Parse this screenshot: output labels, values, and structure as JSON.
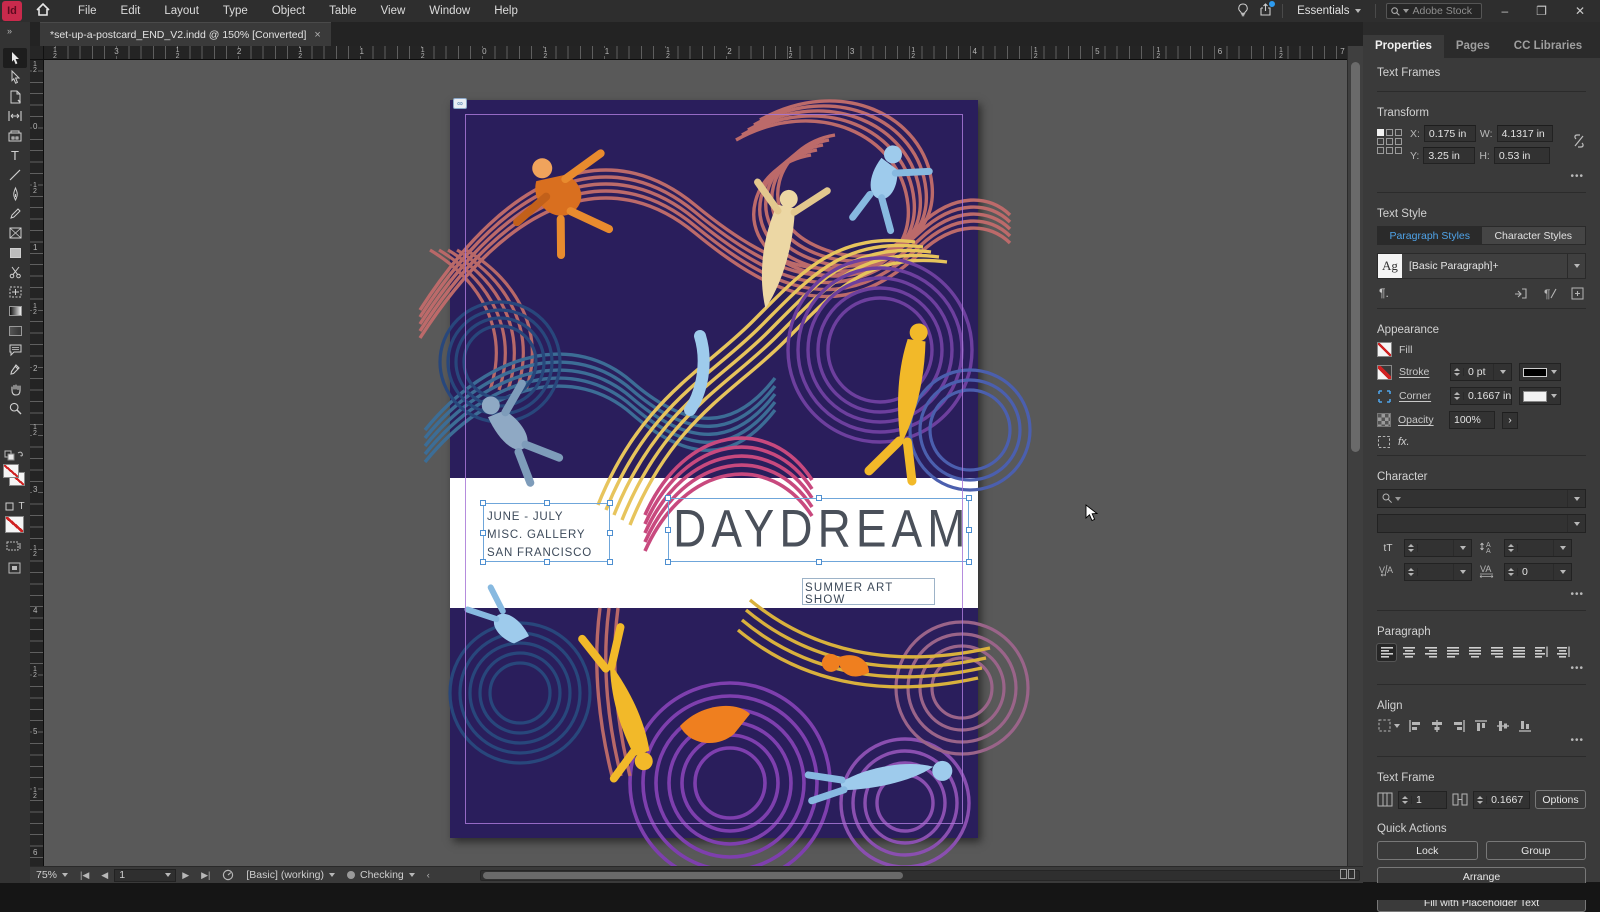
{
  "app": {
    "logo": "Id",
    "menu": [
      "File",
      "Edit",
      "Layout",
      "Type",
      "Object",
      "Table",
      "View",
      "Window",
      "Help"
    ],
    "workspace": "Essentials",
    "search_placeholder": "Adobe Stock",
    "window_buttons": {
      "minimize": "–",
      "restore": "❐",
      "close": "✕"
    }
  },
  "document_tab": {
    "title": "*set-up-a-postcard_END_V2.indd @ 150% [Converted]",
    "close": "×"
  },
  "rulers": {
    "horizontal": [
      "1/2",
      "3",
      "1/2",
      "2",
      "1/2",
      "1",
      "1/2",
      "0",
      "1/2",
      "1",
      "1/2",
      "2",
      "1/2",
      "3",
      "1/2",
      "4",
      "1/2",
      "5",
      "1/2",
      "6",
      "1/2",
      "7"
    ],
    "vertical": [
      "1/2",
      "0",
      "1/2",
      "1",
      "1/2",
      "2",
      "1/2",
      "3",
      "1/2",
      "4",
      "1/2",
      "5",
      "1/2",
      "6"
    ]
  },
  "canvas": {
    "postcard": {
      "venue_line1": "JUNE - JULY",
      "venue_line2": "MISC. GALLERY",
      "venue_line3": "SAN FRANCISCO",
      "title": "DAYDREAM",
      "subtitle": "SUMMER ART SHOW"
    }
  },
  "panel": {
    "tabs": [
      "Properties",
      "Pages",
      "CC Libraries"
    ],
    "selection_label": "Text Frames",
    "transform": {
      "label": "Transform",
      "x_label": "X:",
      "x_value": "0.175 in",
      "y_label": "Y:",
      "y_value": "3.25 in",
      "w_label": "W:",
      "w_value": "4.1317 in",
      "h_label": "H:",
      "h_value": "0.53 in"
    },
    "text_style": {
      "label": "Text Style",
      "tab_paragraph": "Paragraph Styles",
      "tab_character": "Character Styles",
      "ag_glyph": "Ag",
      "style_name": "[Basic Paragraph]+"
    },
    "appearance": {
      "label": "Appearance",
      "fill_label": "Fill",
      "stroke_label": "Stroke",
      "stroke_value": "0 pt",
      "corner_label": "Corner",
      "corner_value": "0.1667 in",
      "opacity_label": "Opacity",
      "opacity_value": "100%",
      "fx_glyph": "fx."
    },
    "character": {
      "label": "Character",
      "font_size_glyph": "tT",
      "tracking_value": "0"
    },
    "paragraph": {
      "label": "Paragraph"
    },
    "align": {
      "label": "Align"
    },
    "text_frame": {
      "label": "Text Frame",
      "columns_value": "1",
      "inset_value": "0.1667",
      "options_label": "Options"
    },
    "quick_actions": {
      "label": "Quick Actions",
      "lock": "Lock",
      "group": "Group",
      "arrange": "Arrange",
      "fill_placeholder": "Fill with Placeholder Text"
    },
    "more_glyph": "•••",
    "pilcrow_glyph": "¶."
  },
  "status_bar": {
    "zoom": "75%",
    "page": "1",
    "preset": "[Basic] (working)",
    "check_label": "Checking",
    "back_glyph": "‹"
  },
  "colors": {
    "accent_blue": "#4fa3e8",
    "selection_blue": "#6fa6da",
    "art_background": "#2a1e5c",
    "guide_violet": "#a878d7"
  }
}
